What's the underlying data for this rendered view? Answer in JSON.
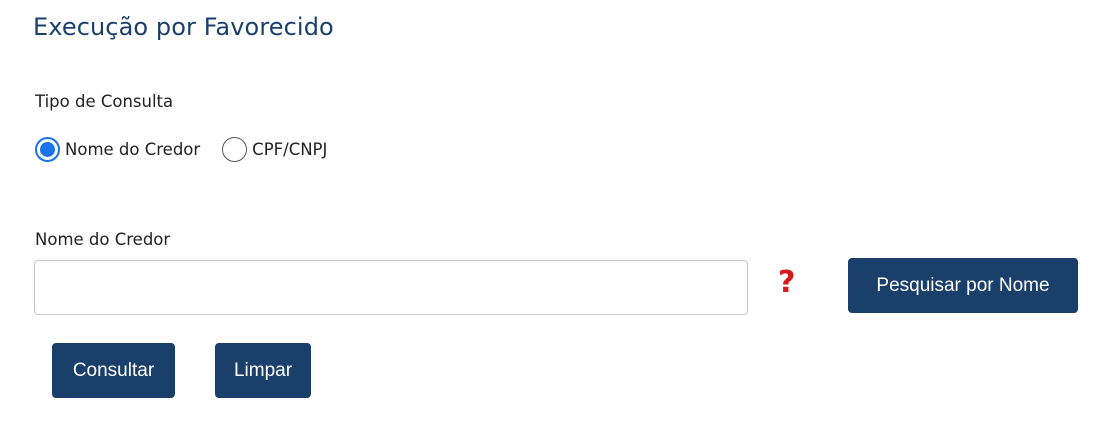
{
  "page": {
    "title": "Execução por Favorecido"
  },
  "query_type": {
    "label": "Tipo de Consulta",
    "options": [
      {
        "label": "Nome do Credor",
        "checked": true
      },
      {
        "label": "CPF/CNPJ",
        "checked": false
      }
    ]
  },
  "creditor_name": {
    "label": "Nome do Credor",
    "value": "",
    "help_symbol": "?"
  },
  "buttons": {
    "search_by_name": "Pesquisar por Nome",
    "consult": "Consultar",
    "clear": "Limpar"
  },
  "colors": {
    "primary": "#1b3f6b",
    "radio_accent": "#1a73e8",
    "help_icon": "#d7191c"
  }
}
